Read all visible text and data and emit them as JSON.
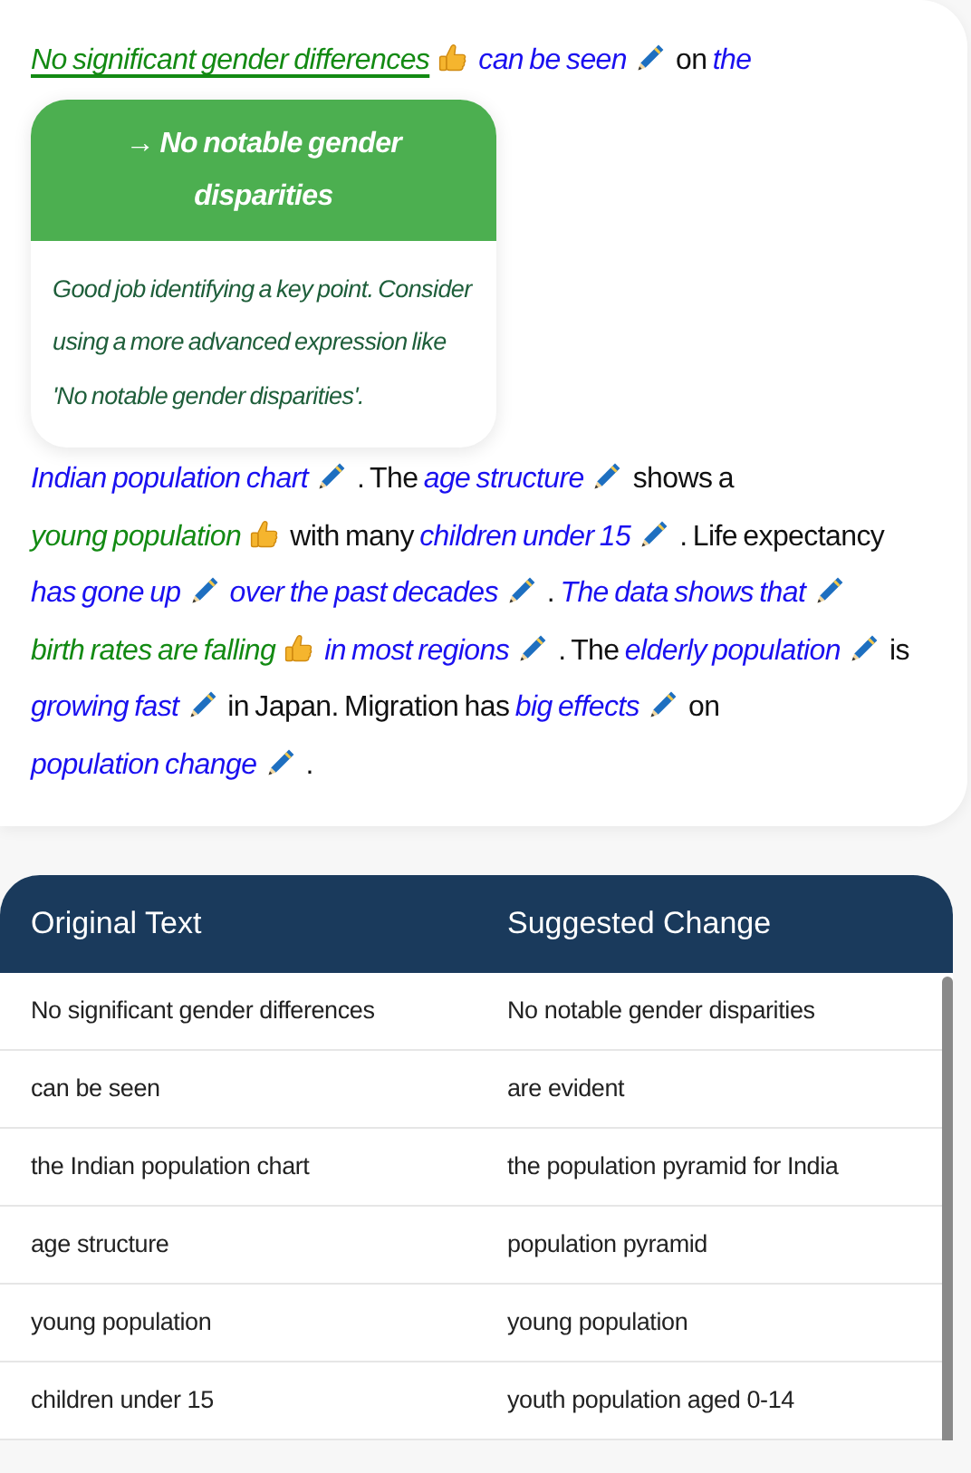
{
  "passage": {
    "lead_segments": [
      {
        "kind": "good",
        "text": "No significant gender differences",
        "active": true
      },
      {
        "kind": "edit",
        "text": "can be seen",
        "active": false
      },
      {
        "kind": "plain",
        "text": "on"
      },
      {
        "kind": "edit-start",
        "text": "the",
        "active": false
      }
    ],
    "tooltip": {
      "arrow": "→",
      "suggestion": "No notable gender disparities",
      "feedback": "Good job identifying a key point. Consider using a more advanced expression like 'No notable gender disparities'."
    },
    "segments": [
      {
        "kind": "edit",
        "text": "Indian population chart",
        "active": false
      },
      {
        "kind": "plain",
        "text": ". The"
      },
      {
        "kind": "edit",
        "text": "age structure",
        "active": false
      },
      {
        "kind": "plain",
        "text": "shows a"
      },
      {
        "kind": "good",
        "text": "young population",
        "active": false
      },
      {
        "kind": "plain",
        "text": "with many"
      },
      {
        "kind": "edit",
        "text": "children under 15",
        "active": false
      },
      {
        "kind": "plain",
        "text": ". Life expectancy"
      },
      {
        "kind": "edit",
        "text": "has gone up",
        "active": false
      },
      {
        "kind": "edit",
        "text": "over the past decades",
        "active": false
      },
      {
        "kind": "plain",
        "text": "."
      },
      {
        "kind": "edit-start",
        "text": "The",
        "active": false
      },
      {
        "kind": "edit",
        "text": "data shows that",
        "active": false
      },
      {
        "kind": "good",
        "text": "birth rates are falling",
        "active": false
      },
      {
        "kind": "edit",
        "text": "in most regions",
        "active": false
      },
      {
        "kind": "plain",
        "text": ". The"
      },
      {
        "kind": "edit",
        "text": "elderly population",
        "active": false
      },
      {
        "kind": "plain",
        "text": "is"
      },
      {
        "kind": "edit",
        "text": "growing fast",
        "active": false
      },
      {
        "kind": "plain",
        "text": "in Japan. Migration has"
      },
      {
        "kind": "edit",
        "text": "big effects",
        "active": false
      },
      {
        "kind": "plain",
        "text": "on"
      },
      {
        "kind": "edit",
        "text": "population change",
        "active": false
      },
      {
        "kind": "plain",
        "text": "."
      }
    ]
  },
  "table": {
    "columns": [
      "Original Text",
      "Suggested Change"
    ],
    "rows": [
      [
        "No significant gender differences",
        "No notable gender disparities"
      ],
      [
        "can be seen",
        "are evident"
      ],
      [
        "the Indian population chart",
        "the population pyramid for India"
      ],
      [
        "age structure",
        "population pyramid"
      ],
      [
        "young population",
        "young population"
      ],
      [
        "children under 15",
        "youth population aged 0-14"
      ]
    ]
  }
}
